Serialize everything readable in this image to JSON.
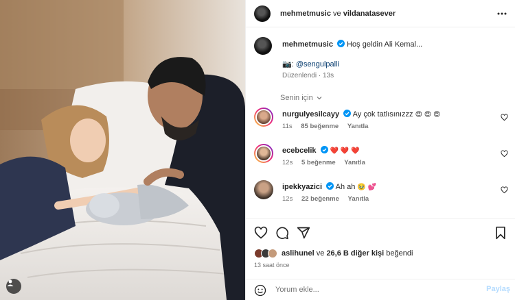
{
  "post": {
    "author": "mehmetmusic",
    "joiner": "ve",
    "coauthor": "vildanatasever"
  },
  "caption": {
    "username": "mehmetmusic",
    "text": "Hoş geldin Ali Kemal...",
    "credit_prefix": "📷:",
    "credit_handle": "@sengulpalli",
    "edited_label": "Düzenlendi",
    "separator": "·",
    "time": "13s"
  },
  "sort": {
    "label": "Senin için"
  },
  "comments": [
    {
      "username": "nurgulyesilcayy",
      "text": "Ay çok tatlısınızzz",
      "emojis": "😍 😍 😍",
      "time": "11s",
      "likes": "85 beğenme",
      "reply": "Yanıtla",
      "story_ring": true
    },
    {
      "username": "ecebcelik",
      "text": "",
      "emojis": "❤️ ❤️ ❤️",
      "time": "12s",
      "likes": "5 beğenme",
      "reply": "Yanıtla",
      "story_ring": true
    },
    {
      "username": "ipekkyazici",
      "text": "Ah ah",
      "emojis": "🥹 💕",
      "time": "12s",
      "likes": "22 beğenme",
      "reply": "Yanıtla",
      "story_ring": false
    }
  ],
  "likes": {
    "user": "aslihunel",
    "joiner": "ve",
    "others": "26,6 B diğer kişi",
    "suffix": "beğendi"
  },
  "time_ago": "13 saat önce",
  "add_comment": {
    "placeholder": "Yorum ekle...",
    "post_label": "Paylaş"
  },
  "colors": {
    "link": "#00376b",
    "verified": "#0095f6",
    "muted": "#737373",
    "post_disabled": "#b3dbff"
  },
  "icons": [
    "more-icon",
    "verified-icon",
    "chevron-down-icon",
    "heart-icon",
    "comment-icon",
    "share-icon",
    "bookmark-icon",
    "emoji-icon",
    "tagged-user-icon"
  ]
}
